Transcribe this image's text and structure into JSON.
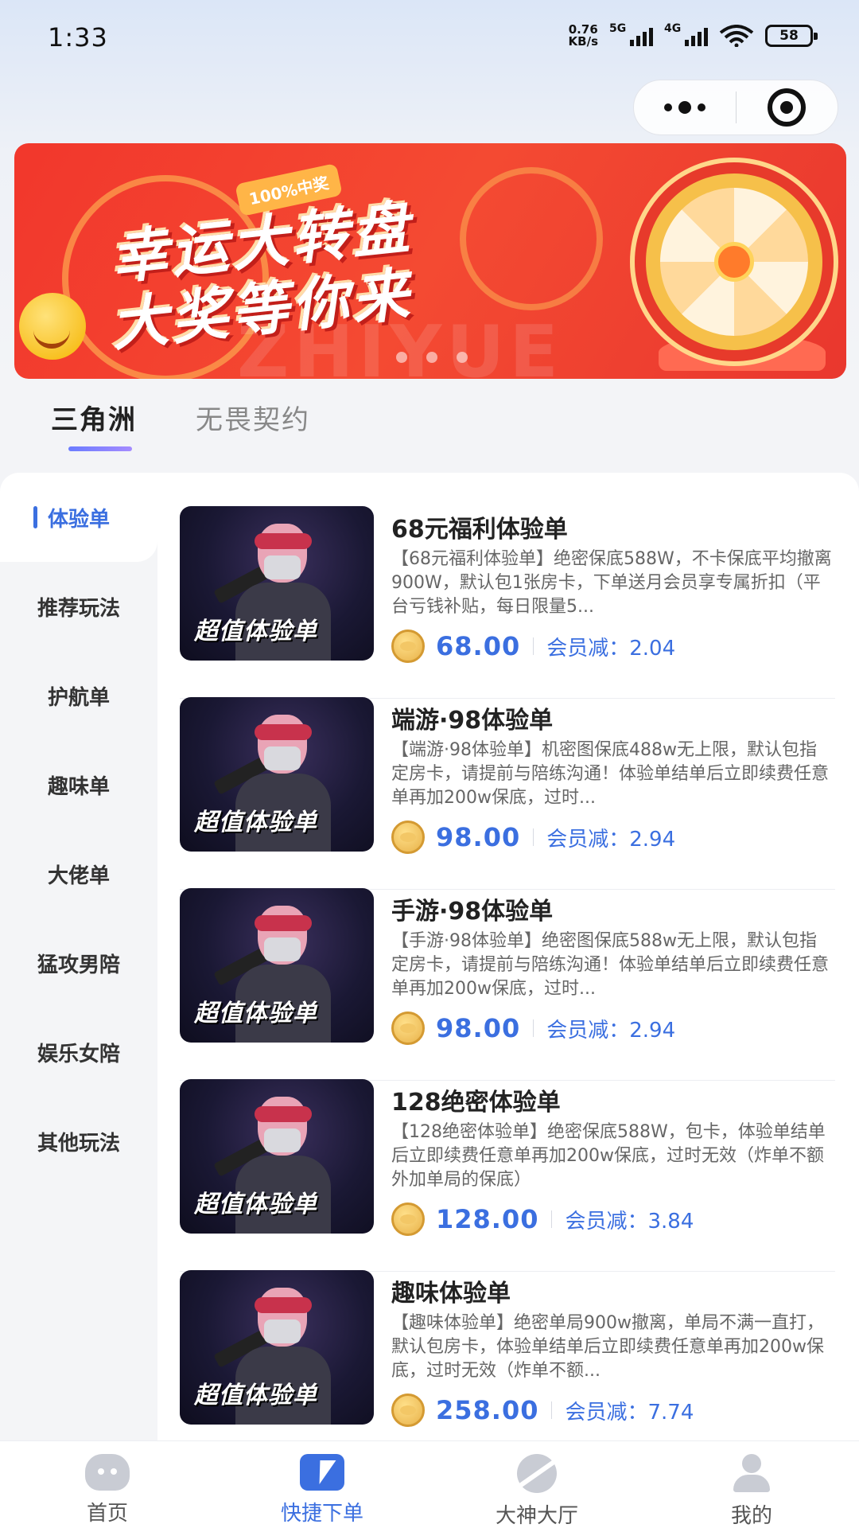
{
  "status_bar": {
    "time": "1:33",
    "net_speed_value": "0.76",
    "net_speed_unit": "KB/s",
    "signal1_tag": "5G",
    "signal2_tag": "4G",
    "battery": "58"
  },
  "banner": {
    "badge": "100%中奖",
    "line1": "幸运大转盘",
    "line2": "大奖等你来",
    "watermark": "ZHIYUE"
  },
  "game_tabs": [
    {
      "label": "三角洲"
    },
    {
      "label": "无畏契约"
    }
  ],
  "sidebar": {
    "items": [
      {
        "label": "体验单"
      },
      {
        "label": "推荐玩法"
      },
      {
        "label": "护航单"
      },
      {
        "label": "趣味单"
      },
      {
        "label": "大佬单"
      },
      {
        "label": "猛攻男陪"
      },
      {
        "label": "娱乐女陪"
      },
      {
        "label": "其他玩法"
      }
    ]
  },
  "thumb_caption": "超值体验单",
  "products": [
    {
      "title": "68元福利体验单",
      "desc": "【68元福利体验单】绝密保底588W，不卡保底平均撤离900W，默认包1张房卡，下单送月会员享专属折扣（平台亏钱补贴，每日限量5...",
      "price": "68.00",
      "member_off": "会员减：2.04"
    },
    {
      "title": "端游·98体验单",
      "desc": "【端游·98体验单】机密图保底488w无上限，默认包指定房卡，请提前与陪练沟通！体验单结单后立即续费任意单再加200w保底，过时...",
      "price": "98.00",
      "member_off": "会员减：2.94"
    },
    {
      "title": "手游·98体验单",
      "desc": "【手游·98体验单】绝密图保底588w无上限，默认包指定房卡，请提前与陪练沟通！体验单结单后立即续费任意单再加200w保底，过时...",
      "price": "98.00",
      "member_off": "会员减：2.94"
    },
    {
      "title": "128绝密体验单",
      "desc": "【128绝密体验单】绝密保底588W，包卡，体验单结单后立即续费任意单再加200w保底，过时无效（炸单不额外加单局的保底）",
      "price": "128.00",
      "member_off": "会员减：3.84"
    },
    {
      "title": "趣味体验单",
      "desc": "【趣味体验单】绝密单局900w撤离，单局不满一直打，默认包房卡，体验单结单后立即续费任意单再加200w保底，过时无效（炸单不额...",
      "price": "258.00",
      "member_off": "会员减：7.74"
    }
  ],
  "bottom_nav": [
    {
      "label": "首页",
      "icon": "home-icon"
    },
    {
      "label": "快捷下单",
      "icon": "quick-order-icon"
    },
    {
      "label": "大神大厅",
      "icon": "hall-icon"
    },
    {
      "label": "我的",
      "icon": "profile-icon"
    }
  ],
  "colors": {
    "accent": "#3b6fe0",
    "banner_red": "#f2372c"
  }
}
